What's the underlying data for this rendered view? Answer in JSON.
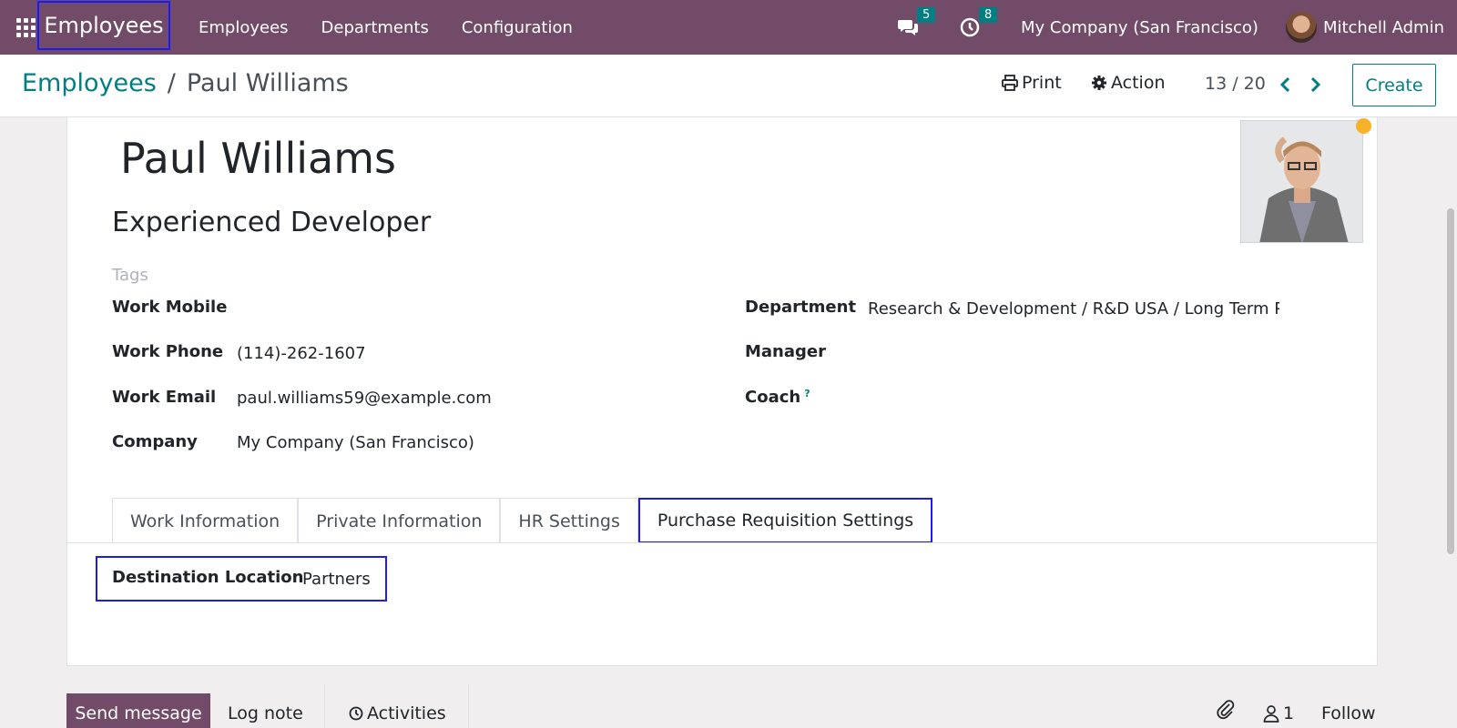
{
  "navbar": {
    "brand": "Employees",
    "menu": [
      "Employees",
      "Departments",
      "Configuration"
    ],
    "messages_count": "5",
    "activities_count": "8",
    "company": "My Company (San Francisco)",
    "user": "Mitchell Admin"
  },
  "control_panel": {
    "breadcrumb_parent": "Employees",
    "breadcrumb_current": "Paul Williams",
    "print_label": "Print",
    "action_label": "Action",
    "pager": "13 / 20",
    "create_label": "Create"
  },
  "form": {
    "name": "Paul Williams",
    "job_title": "Experienced Developer",
    "tags_placeholder": "Tags",
    "left_fields": [
      {
        "label": "Work Mobile",
        "value": ""
      },
      {
        "label": "Work Phone",
        "value": "(114)-262-1607"
      },
      {
        "label": "Work Email",
        "value": "paul.williams59@example.com"
      },
      {
        "label": "Company",
        "value": "My Company (San Francisco)"
      }
    ],
    "right_fields": [
      {
        "label": "Department",
        "value": "Research & Development / R&D USA / Long Term Pr"
      },
      {
        "label": "Manager",
        "value": ""
      },
      {
        "label": "Coach",
        "value": "",
        "help": "?"
      }
    ],
    "tabs": [
      "Work Information",
      "Private Information",
      "HR Settings",
      "Purchase Requisition Settings"
    ],
    "active_tab": "Purchase Requisition Settings",
    "destination_label": "Destination Location",
    "destination_value": "Partners"
  },
  "chatter": {
    "send_message": "Send message",
    "log_note": "Log note",
    "activities": "Activities",
    "followers_count": "1",
    "follow": "Follow"
  },
  "colors": {
    "brand": "#714b67",
    "accent": "#017e84",
    "highlight": "#1a1aff",
    "status": "#f7b228"
  }
}
